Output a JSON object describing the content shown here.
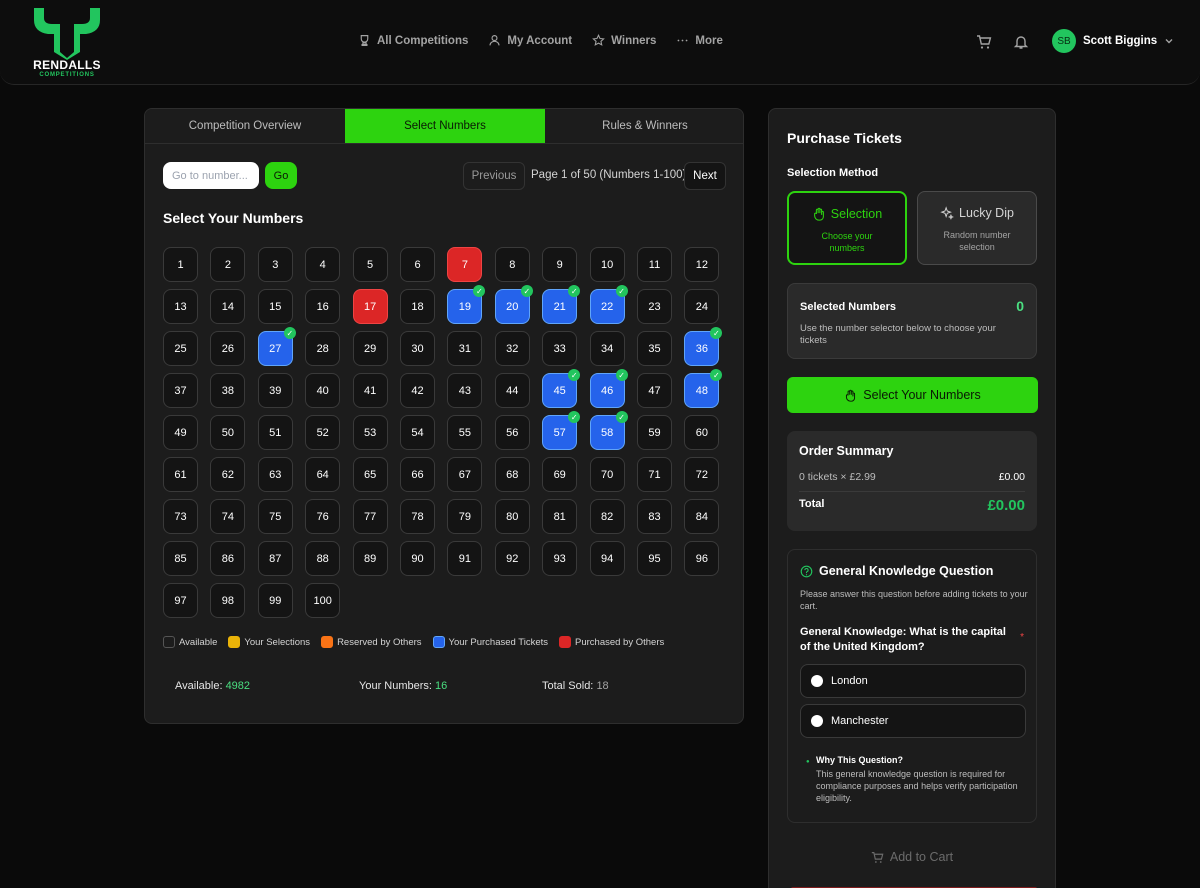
{
  "header": {
    "logo_title": "RENDALLS",
    "logo_sub": "COMPETITIONS",
    "nav": [
      {
        "label": "All Competitions",
        "icon": "trophy-icon"
      },
      {
        "label": "My Account",
        "icon": "user-icon"
      },
      {
        "label": "Winners",
        "icon": "star-icon"
      },
      {
        "label": "More",
        "icon": "ellipsis-icon"
      }
    ],
    "user_initials": "SB",
    "user_name": "Scott Biggins"
  },
  "tabs": [
    "Competition Overview",
    "Select Numbers",
    "Rules & Winners"
  ],
  "active_tab": 1,
  "goto": {
    "placeholder": "Go to number...",
    "go_label": "Go"
  },
  "pager": {
    "previous": "Previous",
    "info": "Page 1 of 50 (Numbers 1-100)",
    "next": "Next"
  },
  "select_title": "Select Your Numbers",
  "numbers": {
    "count": 100,
    "purchased_by_me": [
      19,
      20,
      21,
      22,
      27,
      36,
      45,
      46,
      48,
      57,
      58
    ],
    "purchased_by_others": [
      7,
      17
    ]
  },
  "legend": [
    {
      "label": "Available",
      "color": "#1c1c1c"
    },
    {
      "label": "Your Selections",
      "color": "#eab308"
    },
    {
      "label": "Reserved by Others",
      "color": "#f97316"
    },
    {
      "label": "Your Purchased Tickets",
      "color": "#2563eb"
    },
    {
      "label": "Purchased by Others",
      "color": "#dc2626"
    }
  ],
  "stats": {
    "available_label": "Available:",
    "available_value": "4982",
    "yours_label": "Your Numbers:",
    "yours_value": "16",
    "sold_label": "Total Sold:",
    "sold_value": "18"
  },
  "purchase": {
    "title": "Purchase Tickets",
    "method_label": "Selection Method",
    "method_selection": {
      "label": "Selection",
      "sub": "Choose your numbers",
      "icon": "hand-icon"
    },
    "method_lucky": {
      "label": "Lucky Dip",
      "sub": "Random number selection",
      "icon": "sparkle-icon"
    },
    "selected_title": "Selected Numbers",
    "selected_count": "0",
    "selected_desc": "Use the number selector below to choose your tickets",
    "select_btn": "Select Your Numbers",
    "order_title": "Order Summary",
    "order_line": "0 tickets × £2.99",
    "order_line_amount": "£0.00",
    "total_label": "Total",
    "total_value": "£0.00"
  },
  "gk": {
    "title": "General Knowledge Question",
    "sub": "Please answer this question before adding tickets to your cart.",
    "question": "General Knowledge: What is the capital of the United Kingdom?",
    "required": "*",
    "options": [
      "London",
      "Manchester"
    ],
    "why_title": "Why This Question?",
    "why_desc": "This general knowledge question is required for compliance purposes and helps verify participation eligibility."
  },
  "add_to_cart": "Add to Cart",
  "colors": {
    "accent": "#2dd30f",
    "mine": "#2563eb",
    "others": "#dc2626"
  }
}
